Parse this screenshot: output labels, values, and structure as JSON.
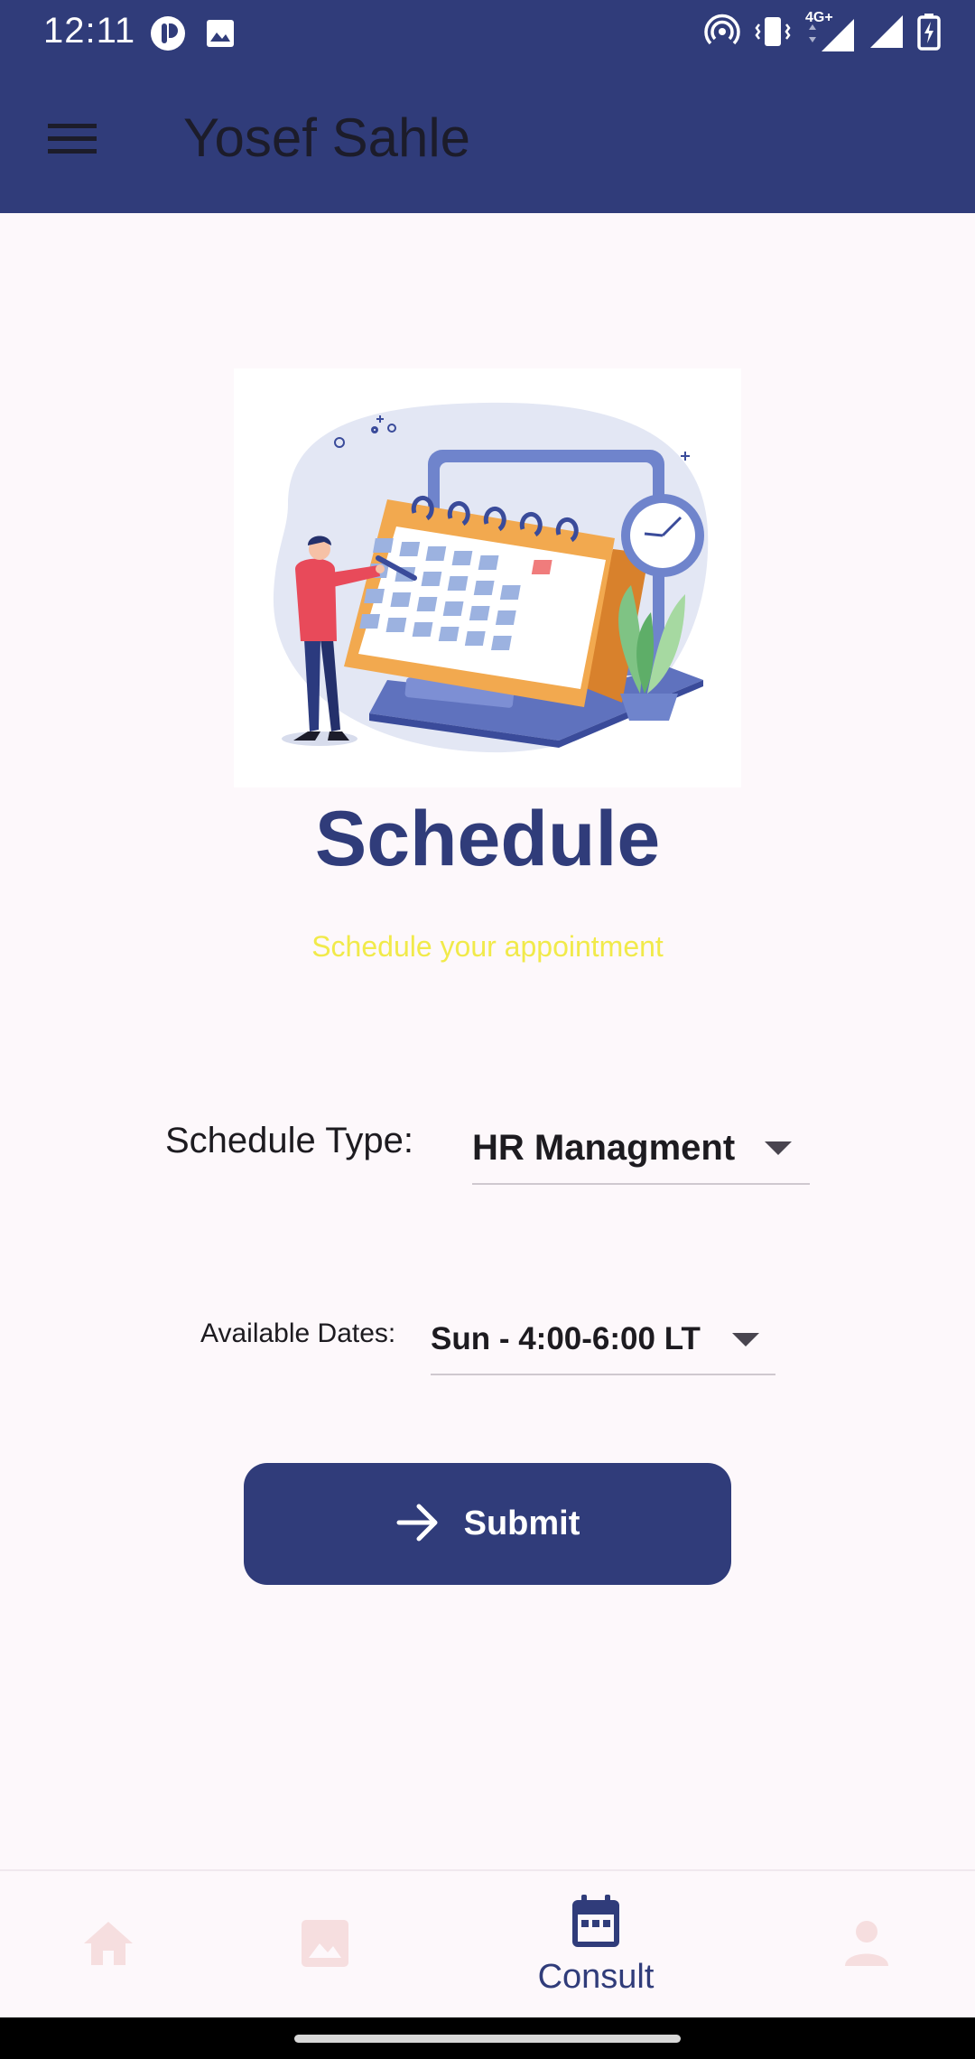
{
  "status_bar": {
    "time": "12:11",
    "network_label": "4G+"
  },
  "app_bar": {
    "title": "Yosef Sahle"
  },
  "main": {
    "title": "Schedule",
    "subtitle": "Schedule your appointment",
    "schedule_type": {
      "label": "Schedule Type:",
      "value": "HR Managment"
    },
    "available_dates": {
      "label": "Available Dates:",
      "value": "Sun - 4:00-6:00 LT"
    },
    "submit_label": "Submit"
  },
  "bottom_nav": {
    "items": [
      {
        "icon": "home-icon",
        "label": "",
        "active": false
      },
      {
        "icon": "image-icon",
        "label": "",
        "active": false
      },
      {
        "icon": "calendar-icon",
        "label": "Consult",
        "active": true
      },
      {
        "icon": "person-icon",
        "label": "",
        "active": false
      }
    ]
  },
  "colors": {
    "primary": "#303c7a",
    "subtitle": "#f1ea4a",
    "background": "#fdf8fb",
    "inactive_nav_icon": "#f6dedf"
  }
}
